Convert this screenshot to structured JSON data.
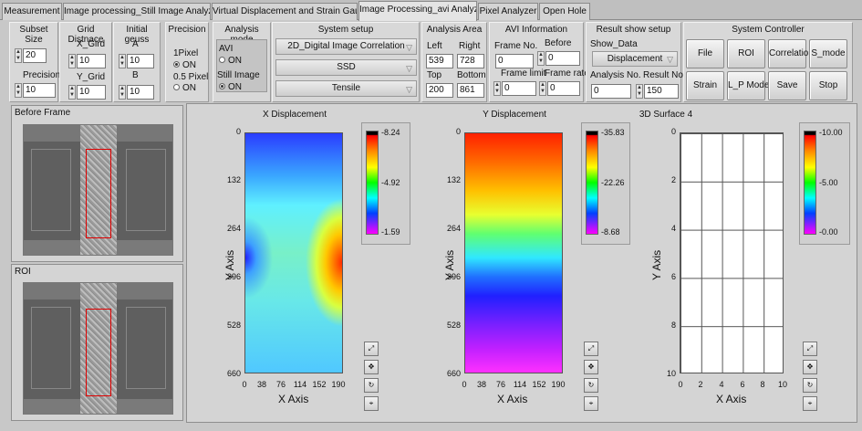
{
  "tabs": [
    "Measurement",
    "Image processing_Still Image Analyzer",
    "Virtual Displacement and Strain Gauge",
    "Image Processing_avi Analyzer",
    "Pixel Analyzer",
    "Open Hole"
  ],
  "subset": {
    "title": "Subset Size",
    "value": "20",
    "precision_label": "Precision",
    "precision": "10"
  },
  "grid": {
    "title": "Grid Distnace",
    "x_label": "X_Gird",
    "x": "10",
    "y_label": "Y_Grid",
    "y": "10"
  },
  "initial": {
    "title": "Initial geuss",
    "a_label": "A",
    "a": "10",
    "b_label": "B",
    "b": "10"
  },
  "precision": {
    "title": "Precision",
    "opt1": "1Pixel",
    "opt1_state": "ON",
    "opt2": "0.5 Pixel",
    "opt2_state": "ON"
  },
  "analysis_mode": {
    "title": "Analysis mode",
    "avi": "AVI",
    "avi_state": "ON",
    "still": "Still Image",
    "still_state": "ON"
  },
  "system_setup": {
    "title": "System setup",
    "method": "2D_Digital Image Correlation",
    "criterion": "SSD",
    "test": "Tensile"
  },
  "analysis_area": {
    "title": "Analysis Area",
    "left_label": "Left",
    "left": "539",
    "right_label": "Right",
    "right": "728",
    "top_label": "Top",
    "top": "200",
    "bottom_label": "Bottom",
    "bottom": "861"
  },
  "avi_info": {
    "title": "AVI  Information",
    "frame_no_label": "Frame No.",
    "frame_no": "0",
    "before_label": "Before",
    "before": "0",
    "frame_limit_label": "Frame limit",
    "frame_limit": "0",
    "frame_rate_label": "Frame rate",
    "frame_rate": "0"
  },
  "result_setup": {
    "title": "Result show setup",
    "show_data_label": "Show_Data",
    "show_data": "Displacement",
    "analysis_no_label": "Analysis No.",
    "analysis_no": "0",
    "result_no_label": "Result No.",
    "result_no": "150"
  },
  "controller": {
    "title": "System Controller",
    "buttons": [
      "File",
      "ROI",
      "Correlation",
      "S_mode",
      "Strain",
      "L_P Mode",
      "Save",
      "Stop"
    ]
  },
  "frames": {
    "before": "Before Frame",
    "roi": "ROI"
  },
  "plots": [
    {
      "title": "X Displacement",
      "xlabel": "X Axis",
      "ylabel": "Y Axis",
      "xticks": [
        "0",
        "38",
        "76",
        "114",
        "152",
        "190"
      ],
      "yticks": [
        "0",
        "132",
        "264",
        "396",
        "528",
        "660"
      ],
      "cbar": [
        "-8.24",
        "-4.92",
        "-1.59"
      ]
    },
    {
      "title": "Y Displacement",
      "xlabel": "X Axis",
      "ylabel": "Y Axis",
      "xticks": [
        "0",
        "38",
        "76",
        "114",
        "152",
        "190"
      ],
      "yticks": [
        "0",
        "132",
        "264",
        "396",
        "528",
        "660"
      ],
      "cbar": [
        "-35.83",
        "-22.26",
        "-8.68"
      ]
    },
    {
      "title": "3D Surface 4",
      "xlabel": "X Axis",
      "ylabel": "Y Axis",
      "xticks": [
        "0",
        "2",
        "4",
        "6",
        "8",
        "10"
      ],
      "yticks": [
        "0",
        "2",
        "4",
        "6",
        "8",
        "10"
      ],
      "cbar": [
        "-10.00",
        "-5.00",
        "-0.00"
      ]
    }
  ],
  "colors": {
    "panel": "#d8d8d8",
    "accent_red": "#e00000",
    "heat_blue": "#2a3cff",
    "heat_red": "#ff2a00"
  },
  "icons": [
    "zoom-icon",
    "pan-icon",
    "rotate-icon",
    "pointer-icon"
  ]
}
